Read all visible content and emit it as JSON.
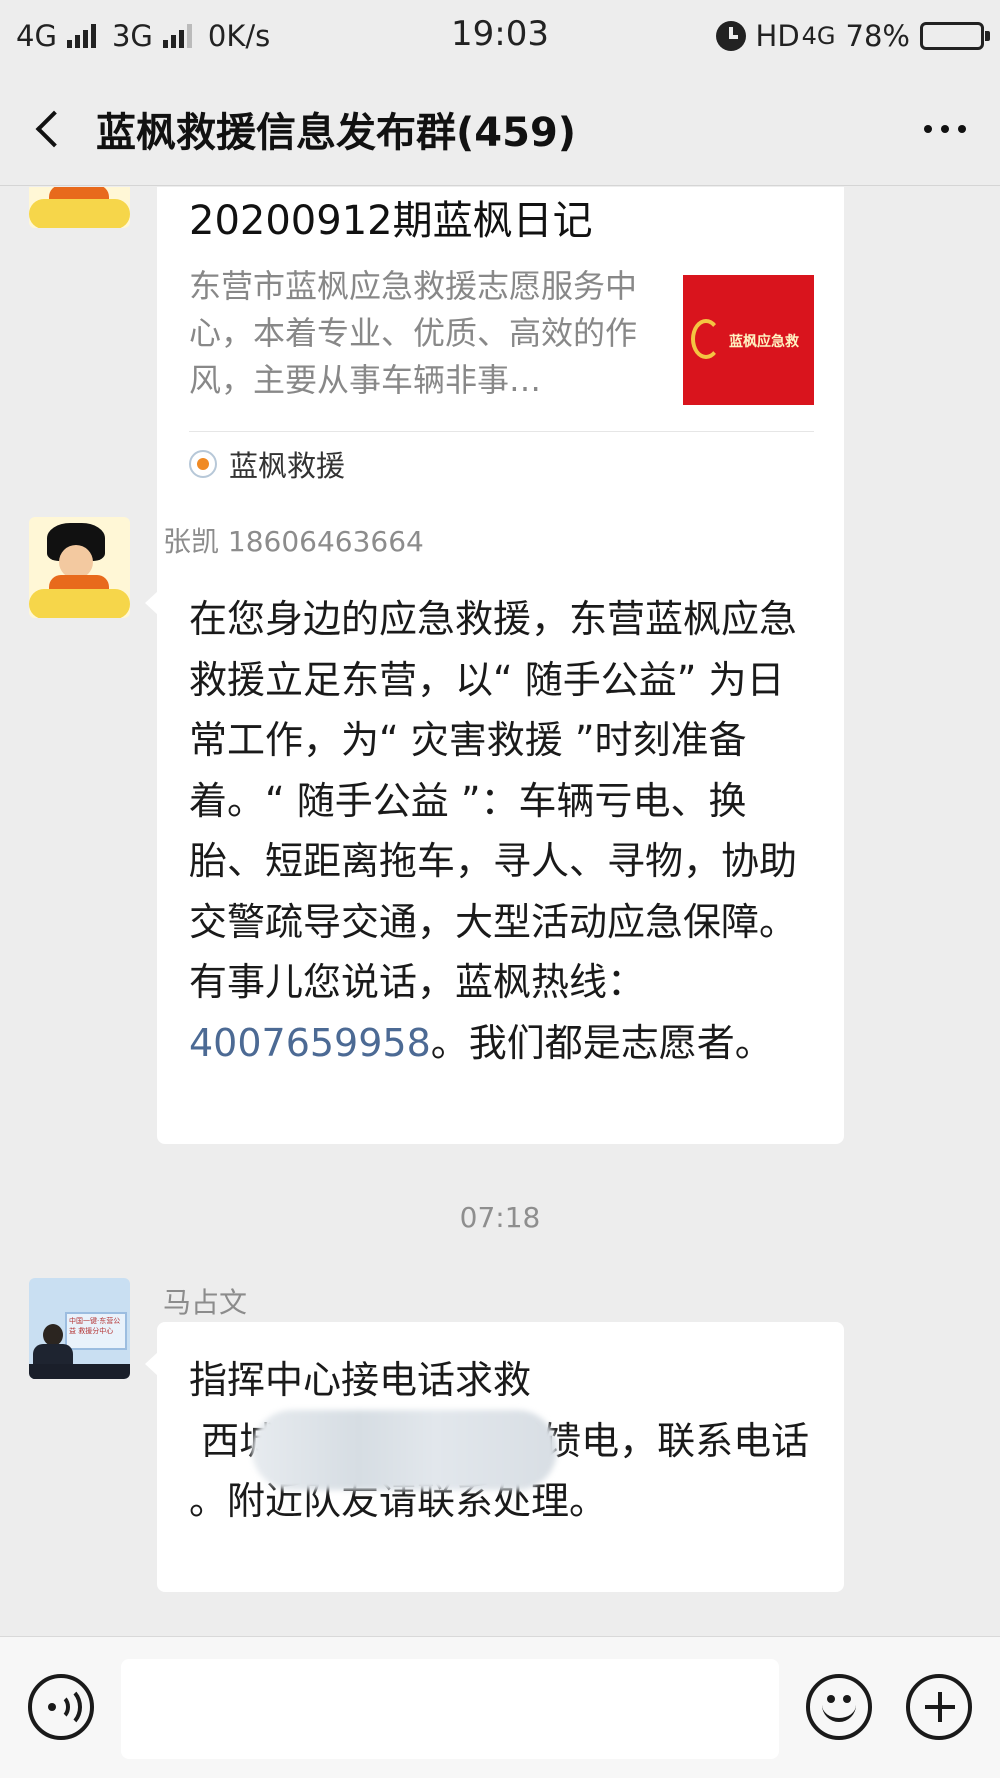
{
  "status_bar": {
    "network1": "4G",
    "network2": "3G",
    "speed": "0K/s",
    "time": "19:03",
    "hd": "HD",
    "network3": "4G",
    "battery": "78%",
    "battery_level": 0.78
  },
  "header": {
    "title": "蓝枫救援信息发布群(459)"
  },
  "messages": [
    {
      "type": "link-card",
      "card_title": "20200912期蓝枫日记",
      "card_desc": "东营市蓝枫应急救援志愿服务中心，本着专业、优质、高效的作风，主要从事车辆非事…",
      "thumb_text": "蓝枫应急救",
      "source": "蓝枫救援"
    },
    {
      "type": "text",
      "sender": "张凯 18606463664",
      "text_before": "在您身边的应急救援，东营蓝枫应急救援立足东营，以“ 随手公益” 为日常工作，为“ 灾害救援 ”时刻准备着。“ 随手公益 ”：车辆亏电、换胎、短距离拖车，寻人、寻物，协助交警疏导交通，大型活动应急保障。有事儿您说话，蓝枫热线：",
      "phone": "4007659958",
      "text_after": "。我们都是志愿者。"
    },
    {
      "type": "timestamp",
      "text": "07:18"
    },
    {
      "type": "text",
      "sender": "马占文",
      "line1": "指挥中心接电话求救",
      "line2": " 西城北一路盛世龙城馈电，联系电话",
      "line3": "。附近队友请联系处理。",
      "avatar_banner": "中国一键·东营公益 救援分中心"
    }
  ],
  "input_bar": {
    "placeholder": ""
  }
}
